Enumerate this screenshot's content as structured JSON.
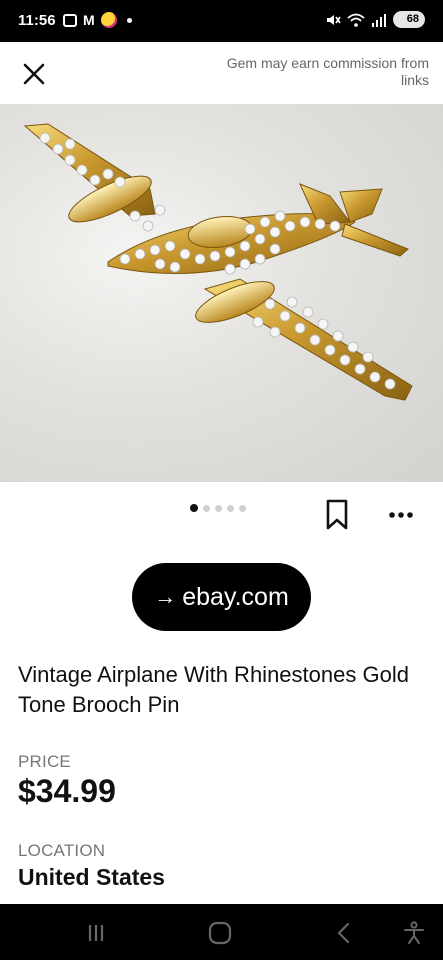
{
  "status_bar": {
    "time": "11:56",
    "battery": "68",
    "icons": [
      "screenshot-icon",
      "gmail-icon",
      "emoji-icon",
      "notification-dot",
      "mute-icon",
      "wifi-icon",
      "signal-icon",
      "battery-icon"
    ]
  },
  "header": {
    "close_icon": "close-icon",
    "commission_text": "Gem may earn commission from links"
  },
  "gallery": {
    "image_count": 5,
    "active_index": 0,
    "bookmark_icon": "bookmark-icon",
    "more_icon": "more-horizontal-icon"
  },
  "cta": {
    "arrow": "→",
    "label": "ebay.com"
  },
  "product": {
    "title": "Vintage Airplane With Rhinestones Gold Tone Brooch Pin",
    "price_label": "PRICE",
    "price": "$34.99",
    "location_label": "LOCATION",
    "location": "United States"
  },
  "nav_bar": {
    "icons": [
      "recent-apps-icon",
      "home-icon",
      "back-icon",
      "accessibility-icon"
    ]
  },
  "colors": {
    "primary": "#000000",
    "gold": "#c99a2e",
    "muted_text": "#777777"
  }
}
